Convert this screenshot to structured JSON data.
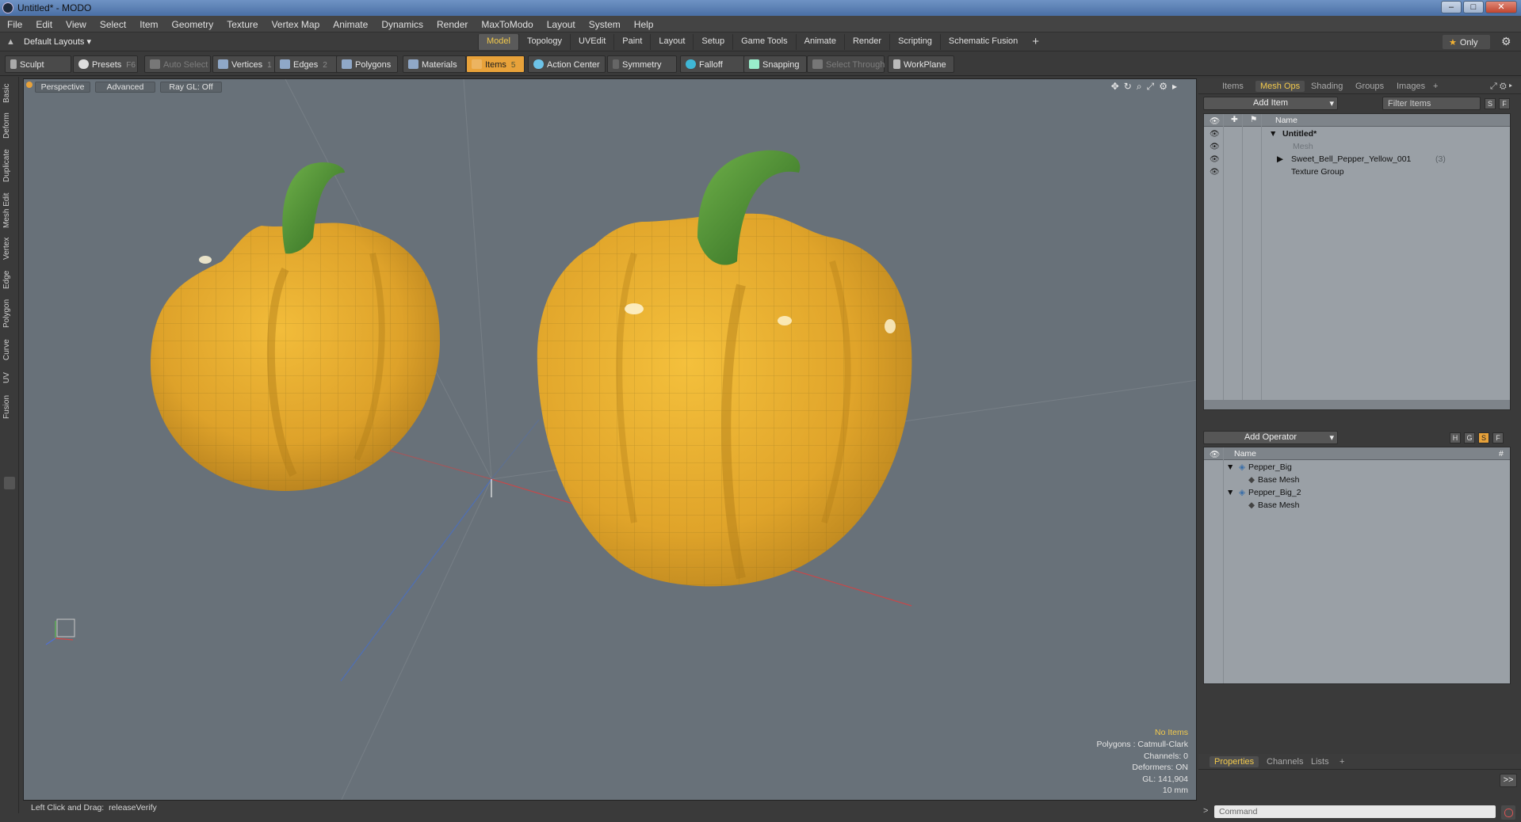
{
  "window": {
    "title": "Untitled* - MODO",
    "controls": [
      "–",
      "□",
      "✕"
    ]
  },
  "menu": [
    "File",
    "Edit",
    "View",
    "Select",
    "Item",
    "Geometry",
    "Texture",
    "Vertex Map",
    "Animate",
    "Dynamics",
    "Render",
    "MaxToModo",
    "Layout",
    "System",
    "Help"
  ],
  "layout_bar": {
    "layouts_label": "Default Layouts",
    "tabs": [
      "Model",
      "Topology",
      "UVEdit",
      "Paint",
      "Layout",
      "Setup",
      "Game Tools",
      "Animate",
      "Render",
      "Scripting",
      "Schematic Fusion"
    ],
    "active_tab": "Model",
    "add_tab": "+",
    "only_label": "Only"
  },
  "toolbar": {
    "sculpt": "Sculpt",
    "presets": "Presets",
    "presets_key": "F6",
    "auto_select": "Auto Select",
    "vertices": "Vertices",
    "vertices_key": "1",
    "edges": "Edges",
    "edges_key": "2",
    "polygons": "Polygons",
    "materials": "Materials",
    "items": "Items",
    "items_key": "5",
    "action_center": "Action Center",
    "symmetry": "Symmetry",
    "falloff": "Falloff",
    "snapping": "Snapping",
    "select_through": "Select Through",
    "workplane": "WorkPlane"
  },
  "left_tabs": [
    "Basic",
    "Deform",
    "Duplicate",
    "Mesh Edit",
    "Vertex",
    "Edge",
    "Polygon",
    "Curve",
    "UV",
    "Fusion"
  ],
  "viewport": {
    "view_mode": "Perspective",
    "shading": "Advanced",
    "raygl": "Ray GL: Off",
    "stats": {
      "no_items": "No Items",
      "polygons": "Polygons : Catmull-Clark",
      "channels": "Channels: 0",
      "deformers": "Deformers: ON",
      "gl": "GL: 141,904",
      "scale": "10 mm"
    }
  },
  "status_bar": {
    "hint_label": "Left Click and Drag:",
    "hint_value": "releaseVerify"
  },
  "items_panel": {
    "tabs": [
      "Items",
      "Mesh Ops",
      "Shading",
      "Groups",
      "Images"
    ],
    "active_tab": "Mesh Ops",
    "add_item": "Add Item",
    "filter_placeholder": "Filter Items",
    "s_btn": "S",
    "f_btn": "F",
    "name_header": "Name",
    "rows": [
      {
        "label": "Untitled*",
        "bold": true
      },
      {
        "label": "Mesh",
        "dim": true
      },
      {
        "label": "Sweet_Bell_Pepper_Yellow_001",
        "suffix": "(3)"
      },
      {
        "label": "Texture Group"
      }
    ]
  },
  "meshops_panel": {
    "add_operator": "Add Operator",
    "btns": [
      "H",
      "G",
      "S",
      "F"
    ],
    "name_header": "Name",
    "hash_header": "#",
    "rows": [
      {
        "label": "Pepper_Big"
      },
      {
        "label": "Base Mesh"
      },
      {
        "label": "Pepper_Big_2"
      },
      {
        "label": "Base Mesh"
      }
    ]
  },
  "properties_panel": {
    "tabs": [
      "Properties",
      "Channels",
      "Lists"
    ],
    "active_tab": "Properties",
    "expand": ">>"
  },
  "command": {
    "placeholder": "Command"
  },
  "colors": {
    "accent": "#e8a23a",
    "viewport_bg": "#687179",
    "pepper": "#e4a72b",
    "stem": "#4c8a2e"
  }
}
